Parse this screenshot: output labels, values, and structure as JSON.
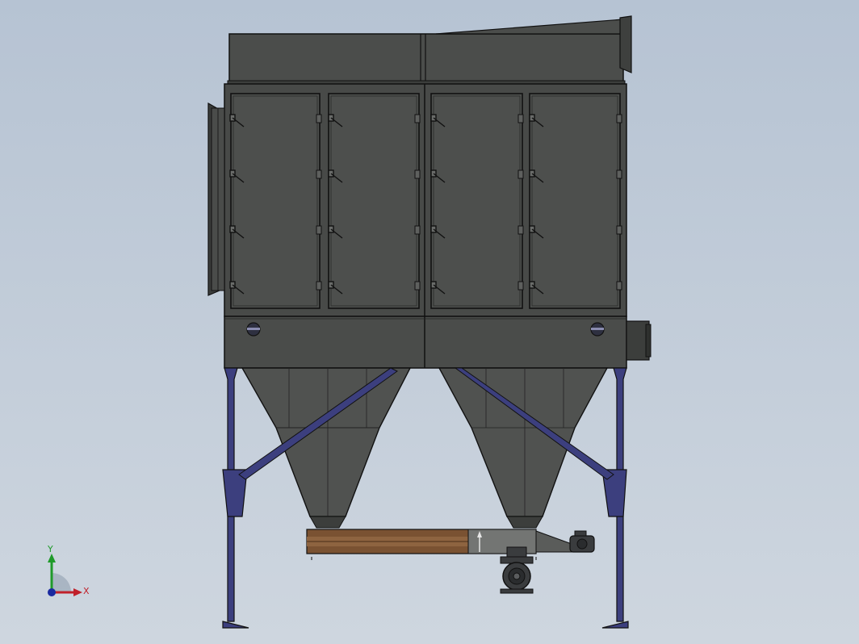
{
  "viewport": {
    "background_top": "#b6c3d3",
    "background_bottom": "#ced6df"
  },
  "colors": {
    "body": "#4a4c4a",
    "body_dark": "#3c3e3c",
    "outline": "#121212",
    "legs": "#3a3d7a",
    "conveyor": "#7a5232",
    "motor": "#3a3c3e"
  },
  "model": {
    "door_count": 4,
    "hopper_count": 2,
    "legs_count": 2
  },
  "triad": {
    "x_label": "X",
    "y_label": "Y",
    "x_color": "#c0202a",
    "y_color": "#1f9a2a",
    "z_color": "#1a2aa0"
  }
}
